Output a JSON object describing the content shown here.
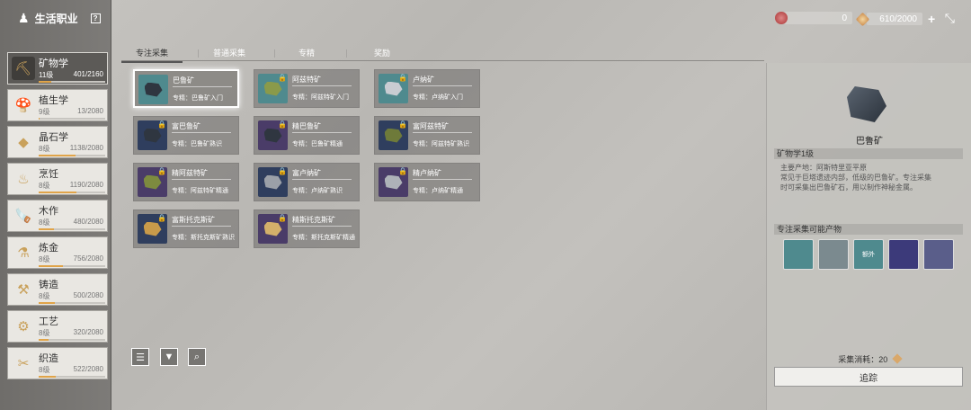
{
  "header": {
    "title": "生活职业",
    "help_label": "?",
    "resource1_value": "0",
    "resource2_value": "610/2000",
    "plus_label": "+",
    "close_label": "⤡"
  },
  "categories": [
    {
      "name": "矿物学",
      "level": "11级",
      "exp": "401/2160",
      "progress": 0.19,
      "icon": "pickaxe-icon",
      "glyph": "⛏"
    },
    {
      "name": "植生学",
      "level": "9级",
      "exp": "13/2080",
      "progress": 0.01,
      "icon": "mushroom-icon",
      "glyph": "🍄"
    },
    {
      "name": "晶石学",
      "level": "8级",
      "exp": "1138/2080",
      "progress": 0.55,
      "icon": "crystal-icon",
      "glyph": "◆"
    },
    {
      "name": "烹饪",
      "level": "8级",
      "exp": "1190/2080",
      "progress": 0.57,
      "icon": "cooking-icon",
      "glyph": "♨"
    },
    {
      "name": "木作",
      "level": "8级",
      "exp": "480/2080",
      "progress": 0.23,
      "icon": "saw-icon",
      "glyph": "🪚"
    },
    {
      "name": "炼金",
      "level": "8级",
      "exp": "756/2080",
      "progress": 0.36,
      "icon": "flask-icon",
      "glyph": "⚗"
    },
    {
      "name": "铸造",
      "level": "8级",
      "exp": "500/2080",
      "progress": 0.24,
      "icon": "anvil-icon",
      "glyph": "⚒"
    },
    {
      "name": "工艺",
      "level": "8级",
      "exp": "320/2080",
      "progress": 0.15,
      "icon": "gear-icon",
      "glyph": "⚙"
    },
    {
      "name": "织造",
      "level": "8级",
      "exp": "522/2080",
      "progress": 0.25,
      "icon": "sewing-machine-icon",
      "glyph": "✂"
    }
  ],
  "tabs": [
    "专注采集",
    "普通采集",
    "专精",
    "奖励"
  ],
  "items": [
    {
      "name": "巴鲁矿",
      "desc": "专精：巴鲁矿入门",
      "locked": false,
      "thumb": "#4f8a8e",
      "ore": "#2f3640"
    },
    {
      "name": "阿兹特矿",
      "desc": "专精：阿兹特矿入门",
      "locked": true,
      "thumb": "#4f8a8e",
      "ore": "#8a9a4a"
    },
    {
      "name": "卢纳矿",
      "desc": "专精：卢纳矿入门",
      "locked": true,
      "thumb": "#4f8a8e",
      "ore": "#c9ccd2"
    },
    {
      "name": "富巴鲁矿",
      "desc": "专精：巴鲁矿熟识",
      "locked": true,
      "thumb": "#2f3e5e",
      "ore": "#2f3640"
    },
    {
      "name": "精巴鲁矿",
      "desc": "专精：巴鲁矿精通",
      "locked": true,
      "thumb": "#4a3c68",
      "ore": "#2f3640"
    },
    {
      "name": "富阿兹特矿",
      "desc": "专精：阿兹特矿熟识",
      "locked": true,
      "thumb": "#2f3e5e",
      "ore": "#6e7a3a"
    },
    {
      "name": "精阿兹特矿",
      "desc": "专精：阿兹特矿精通",
      "locked": true,
      "thumb": "#4a3c68",
      "ore": "#7d8b3f"
    },
    {
      "name": "富卢纳矿",
      "desc": "专精：卢纳矿熟识",
      "locked": true,
      "thumb": "#2f3e5e",
      "ore": "#9ba0a8"
    },
    {
      "name": "精卢纳矿",
      "desc": "专精：卢纳矿精通",
      "locked": true,
      "thumb": "#4a3c68",
      "ore": "#aeb2b8"
    },
    {
      "name": "富斯托克斯矿",
      "desc": "专精：斯托克斯矿熟识",
      "locked": true,
      "thumb": "#2f3e5e",
      "ore": "#c89a4a"
    },
    {
      "name": "精斯托克斯矿",
      "desc": "专精：斯托克斯矿精通",
      "locked": true,
      "thumb": "#4a3c68",
      "ore": "#d4b06a"
    }
  ],
  "detail": {
    "name": "巴鲁矿",
    "skill_requirement": "矿物学1级",
    "info": [
      "主要产地：阿斯特里亚平原",
      "常见于巨塔遗迹内部，低级的巴鲁矿。专注采集",
      "时可采集出巴鲁矿石，用以制作神秘金属。"
    ],
    "products_header": "专注采集可能产物",
    "products": [
      {
        "icon": "ore-icon",
        "color": "#4f8a8e",
        "label": ""
      },
      {
        "icon": "recipe-scroll-icon",
        "color": "#7b8a8f",
        "label": ""
      },
      {
        "icon": "ore-extra-icon",
        "color": "#4f8a8e",
        "label": "额外"
      },
      {
        "icon": "crystal-star-icon",
        "color": "#3c3a7a",
        "label": ""
      },
      {
        "icon": "ingot-icon",
        "color": "#5a5e8a",
        "label": ""
      }
    ],
    "cost_label": "采集消耗：20",
    "track_label": "追踪"
  }
}
